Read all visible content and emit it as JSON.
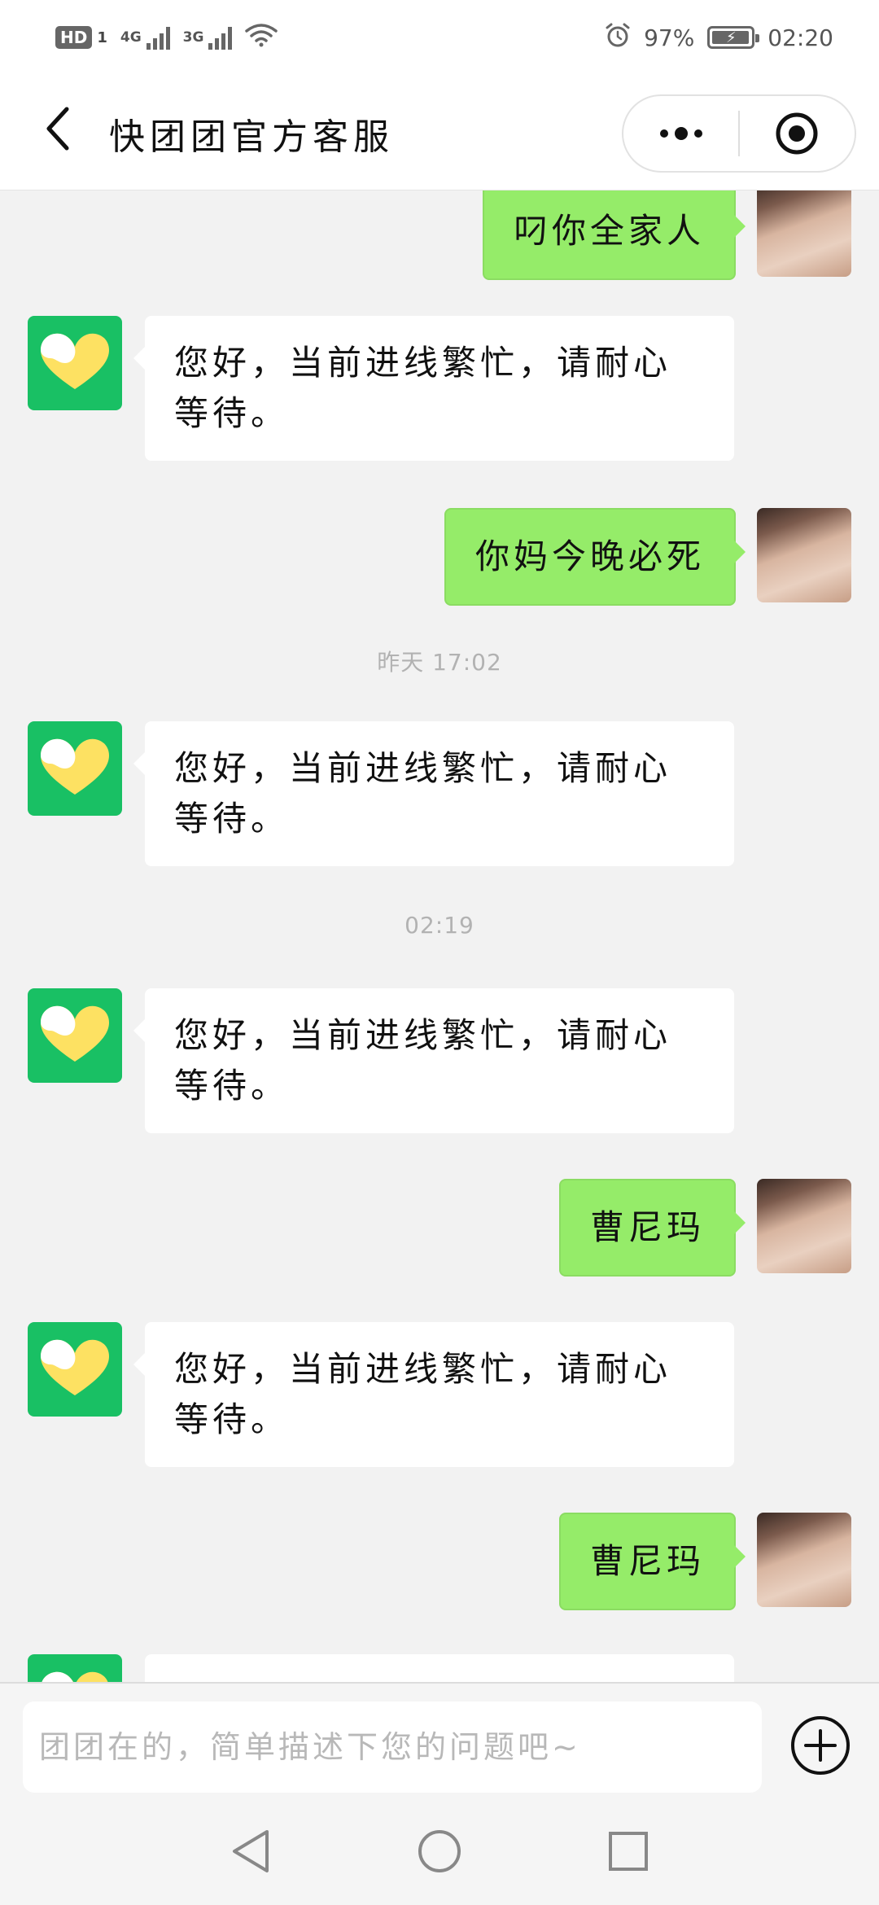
{
  "status_bar": {
    "hd": "HD",
    "sim1": "1",
    "net1": "4G",
    "net2": "3G",
    "battery_text": "97%",
    "battery_level": 0.97,
    "time": "02:20",
    "icons": [
      "signal-icon",
      "wifi-icon",
      "alarm-icon",
      "battery-icon"
    ]
  },
  "header": {
    "title": "快团团官方客服",
    "icons": [
      "back-arrow-icon",
      "more-dots-icon",
      "close-target-icon"
    ]
  },
  "messages": [
    {
      "from": "user",
      "text": "叼你全家人"
    },
    {
      "from": "bot",
      "text": "您好，当前进线繁忙，请耐心等待。"
    },
    {
      "from": "user",
      "text": "你妈今晚必死"
    },
    {
      "type": "time",
      "text": "昨天 17:02"
    },
    {
      "from": "bot",
      "text": "您好，当前进线繁忙，请耐心等待。"
    },
    {
      "type": "time",
      "text": "02:19"
    },
    {
      "from": "bot",
      "text": "您好，当前进线繁忙，请耐心等待。"
    },
    {
      "from": "user",
      "text": "曹尼玛"
    },
    {
      "from": "bot",
      "text": "您好，当前进线繁忙，请耐心等待。"
    },
    {
      "from": "user",
      "text": "曹尼玛"
    },
    {
      "from": "bot",
      "text": ""
    }
  ],
  "input": {
    "placeholder": "团团在的，简单描述下您的问题吧~",
    "value": ""
  },
  "nav": {
    "icons": [
      "nav-back-icon",
      "nav-home-icon",
      "nav-recents-icon"
    ]
  },
  "colors": {
    "user_bubble": "#95ec69",
    "bot_bubble": "#ffffff",
    "bot_avatar": "#19c064",
    "background": "#f2f2f2"
  }
}
